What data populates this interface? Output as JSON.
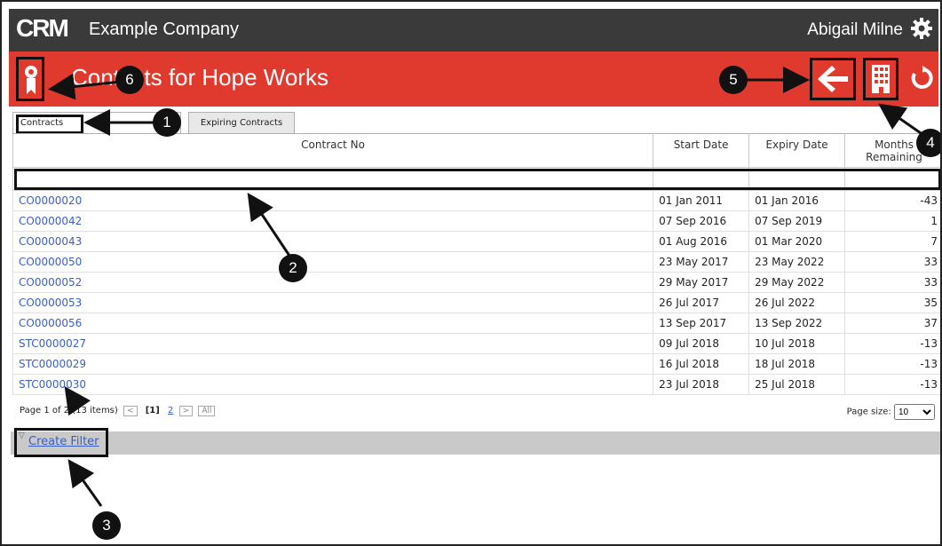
{
  "header": {
    "logo_text": "CRM",
    "company": "Example Company",
    "user": "Abigail Milne",
    "settings_icon": "gear-icon"
  },
  "page": {
    "title": "Contacts for Hope Works",
    "award_icon": "award-icon",
    "back_icon": "arrow-left-icon",
    "building_icon": "building-icon",
    "refresh_icon": "refresh-icon",
    "accent_color": "#e03a2e",
    "topbar_color": "#3a3a3a"
  },
  "tabs": [
    {
      "label": "Contracts",
      "active": true
    },
    {
      "label": "Expiring Contracts",
      "active": false
    }
  ],
  "table": {
    "headers": [
      "Contract No",
      "Start Date",
      "Expiry Date",
      "Months Remaining"
    ],
    "rows": [
      {
        "no": "CO0000020",
        "start": "01 Jan 2011",
        "expiry": "01 Jan 2016",
        "months": "-43"
      },
      {
        "no": "CO0000042",
        "start": "07 Sep 2016",
        "expiry": "07 Sep 2019",
        "months": "1"
      },
      {
        "no": "CO0000043",
        "start": "01 Aug 2016",
        "expiry": "01 Mar 2020",
        "months": "7"
      },
      {
        "no": "CO0000050",
        "start": "23 May 2017",
        "expiry": "23 May 2022",
        "months": "33"
      },
      {
        "no": "CO0000052",
        "start": "29 May 2017",
        "expiry": "29 May 2022",
        "months": "33"
      },
      {
        "no": "CO0000053",
        "start": "26 Jul 2017",
        "expiry": "26 Jul 2022",
        "months": "35"
      },
      {
        "no": "CO0000056",
        "start": "13 Sep 2017",
        "expiry": "13 Sep 2022",
        "months": "37"
      },
      {
        "no": "STC0000027",
        "start": "09 Jul 2018",
        "expiry": "10 Jul 2018",
        "months": "-13"
      },
      {
        "no": "STC0000029",
        "start": "16 Jul 2018",
        "expiry": "18 Jul 2018",
        "months": "-13"
      },
      {
        "no": "STC0000030",
        "start": "23 Jul 2018",
        "expiry": "25 Jul 2018",
        "months": "-13"
      }
    ]
  },
  "pager": {
    "summary": "Page 1 of 2 (13 items)",
    "prev": "<",
    "current": "[1]",
    "page2": "2",
    "next": ">",
    "all": "All",
    "page_size_label": "Page size:",
    "page_size": "10"
  },
  "filter": {
    "create_label": "Create Filter",
    "funnel_icon": "funnel-icon"
  },
  "annotations": [
    "1",
    "2",
    "3",
    "4",
    "5",
    "6"
  ]
}
